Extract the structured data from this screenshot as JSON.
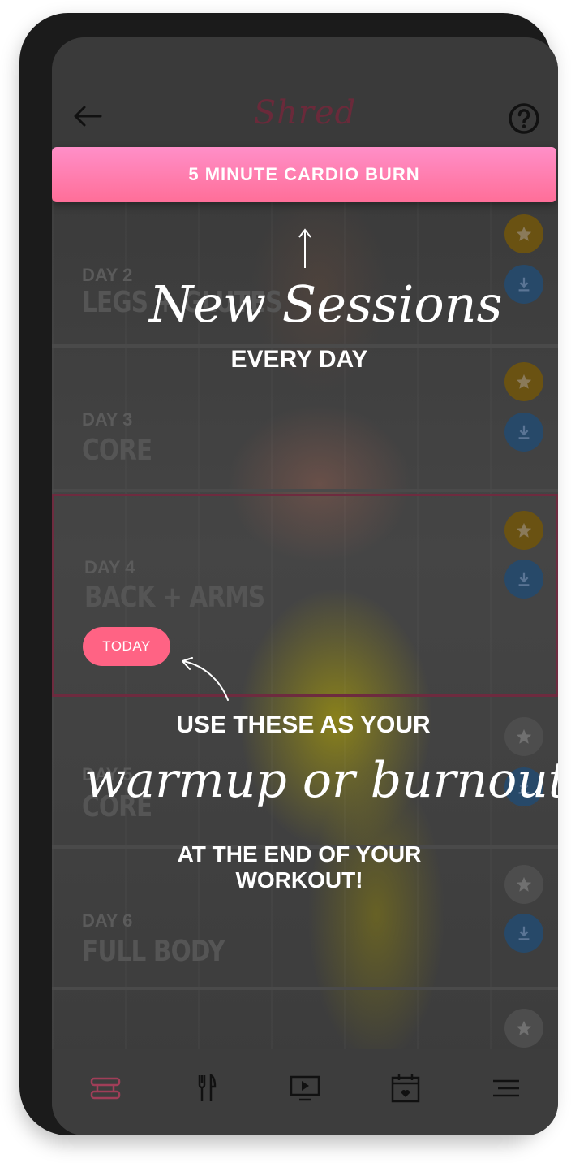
{
  "header": {
    "brand": "Shred",
    "back_icon": "arrow-left-icon",
    "help_icon": "question-circle-icon"
  },
  "banner": {
    "label": "5 MINUTE CARDIO BURN"
  },
  "sessions": [
    {
      "day": "DAY 2",
      "name": "LEGS + GLUTES",
      "starred": true
    },
    {
      "day": "DAY 3",
      "name": "CORE",
      "starred": true
    },
    {
      "day": "DAY 4",
      "name": "BACK + ARMS",
      "starred": true,
      "today": true,
      "today_label": "TODAY"
    },
    {
      "day": "DAY 5",
      "name": "CORE",
      "starred": false
    },
    {
      "day": "DAY 6",
      "name": "FULL BODY",
      "starred": false
    }
  ],
  "overlay": {
    "new_sessions": "New Sessions",
    "every_day": "EVERY DAY",
    "use_these": "USE THESE AS YOUR",
    "warmup_burnout": "warmup or burnout",
    "end_of_workout": "AT THE END OF YOUR WORKOUT!"
  },
  "tabbar": {
    "items": [
      {
        "icon": "dumbbell-icon",
        "active": true
      },
      {
        "icon": "fork-knife-icon",
        "active": false
      },
      {
        "icon": "video-play-icon",
        "active": false
      },
      {
        "icon": "calendar-heart-icon",
        "active": false
      },
      {
        "icon": "menu-icon",
        "active": false
      }
    ]
  },
  "colors": {
    "accent_pink": "#ff6e98",
    "banner_top": "#ff8fc8",
    "today_pill": "#ff6384",
    "star_gold": "#6a5212",
    "download_blue": "#274969",
    "active_tab": "#b0415e"
  }
}
